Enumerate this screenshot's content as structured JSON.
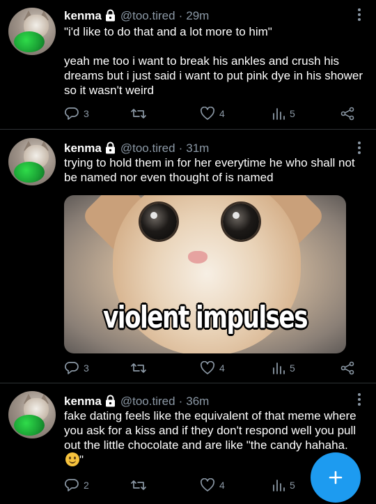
{
  "tweets": [
    {
      "name": "kenma",
      "handle": "@too.tired",
      "separator": "·",
      "time": "29m",
      "text": "\"i'd like to do that and a lot more to him\"\n\nyeah me too i want to break his ankles and crush his dreams but i just said i want to put pink dye in his shower so it wasn't weird",
      "replies": "3",
      "retweets": "",
      "likes": "4",
      "views": "5"
    },
    {
      "name": "kenma",
      "handle": "@too.tired",
      "separator": "·",
      "time": "31m",
      "text": "trying to hold them in for her everytime he who shall not be named nor even thought of is named",
      "media_caption": "violent impulses",
      "replies": "3",
      "retweets": "",
      "likes": "4",
      "views": "5"
    },
    {
      "name": "kenma",
      "handle": "@too.tired",
      "separator": "·",
      "time": "36m",
      "text": "fake dating feels like the equivalent of that meme where you ask for a kiss and if they don't respond well you pull out the little chocolate and are like \"the candy hahaha. ",
      "text_end": "\"",
      "replies": "2",
      "retweets": "",
      "likes": "4",
      "views": "5"
    }
  ],
  "fab": {
    "icon": "plus-icon"
  },
  "colors": {
    "background": "#000000",
    "text": "#ffffff",
    "muted": "#8b98a5",
    "divider": "#2f3336",
    "accent": "#1d9bf0"
  }
}
